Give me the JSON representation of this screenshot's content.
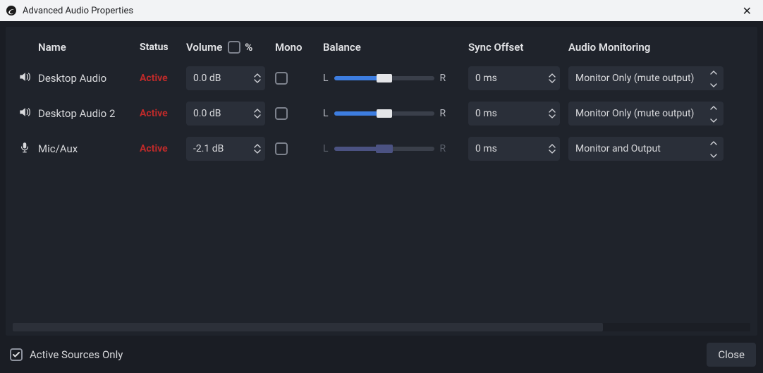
{
  "window": {
    "title": "Advanced Audio Properties",
    "close_glyph": "✕"
  },
  "columns": {
    "name": "Name",
    "status": "Status",
    "volume": "Volume",
    "percent": "%",
    "mono": "Mono",
    "balance": "Balance",
    "sync": "Sync Offset",
    "monitoring": "Audio Monitoring"
  },
  "balance_labels": {
    "left": "L",
    "right": "R"
  },
  "rows": [
    {
      "icon": "speaker",
      "name": "Desktop Audio",
      "status": "Active",
      "volume": "0.0 dB",
      "mono": false,
      "balance_pct": 50,
      "balance_muted": false,
      "sync": "0 ms",
      "monitoring": "Monitor Only (mute output)"
    },
    {
      "icon": "speaker",
      "name": "Desktop Audio 2",
      "status": "Active",
      "volume": "0.0 dB",
      "mono": false,
      "balance_pct": 50,
      "balance_muted": false,
      "sync": "0 ms",
      "monitoring": "Monitor Only (mute output)"
    },
    {
      "icon": "mic",
      "name": "Mic/Aux",
      "status": "Active",
      "volume": "-2.1 dB",
      "mono": false,
      "balance_pct": 50,
      "balance_muted": true,
      "sync": "0 ms",
      "monitoring": "Monitor and Output"
    }
  ],
  "footer": {
    "active_only_checked": true,
    "active_only_label": "Active Sources Only",
    "close_label": "Close"
  },
  "volume_percent_checked": false
}
